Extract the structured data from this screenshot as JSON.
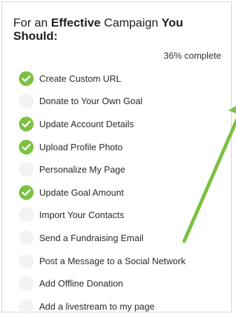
{
  "heading": {
    "prefix": "For an ",
    "strong1": "Effective",
    "middle": " Campaign ",
    "strong2": "You Should:"
  },
  "progress": {
    "percent": 36,
    "label": "36% complete"
  },
  "colors": {
    "check_done": "#7cc142",
    "check_pending": "#f3f3f3",
    "arrow": "#7cc142"
  },
  "tasks": [
    {
      "label": "Create Custom URL",
      "done": true,
      "icon": "checkmark-icon"
    },
    {
      "label": "Donate to Your Own Goal",
      "done": false,
      "icon": "empty-circle-icon"
    },
    {
      "label": "Update Account Details",
      "done": true,
      "icon": "checkmark-icon"
    },
    {
      "label": "Upload Profile Photo",
      "done": true,
      "icon": "checkmark-icon"
    },
    {
      "label": "Personalize My Page",
      "done": false,
      "icon": "empty-circle-icon"
    },
    {
      "label": "Update Goal Amount",
      "done": true,
      "icon": "checkmark-icon"
    },
    {
      "label": "Import Your Contacts",
      "done": false,
      "icon": "empty-circle-icon"
    },
    {
      "label": "Send a Fundraising Email",
      "done": false,
      "icon": "empty-circle-icon"
    },
    {
      "label": "Post a Message to a Social Network",
      "done": false,
      "icon": "empty-circle-icon"
    },
    {
      "label": "Add Offline Donation",
      "done": false,
      "icon": "empty-circle-icon"
    },
    {
      "label": "Add a livestream to my page",
      "done": false,
      "icon": "empty-circle-icon"
    }
  ]
}
